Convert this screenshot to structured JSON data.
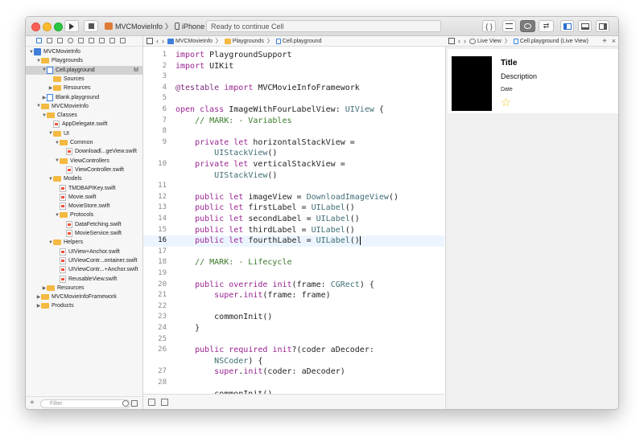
{
  "toolbar": {
    "scheme": "MVCMovieInfo",
    "device": "iPhone Xs",
    "status": "Ready to continue Cell",
    "curly_label": "{ }"
  },
  "navigator": {
    "filter_placeholder": "Filter",
    "tree": [
      {
        "label": "MVCMovieInfo",
        "icon": "project",
        "depth": 0,
        "disclosure": "open"
      },
      {
        "label": "Playgrounds",
        "icon": "folder",
        "depth": 1,
        "disclosure": "open"
      },
      {
        "label": "Cell.playground",
        "icon": "playground",
        "depth": 2,
        "disclosure": "open",
        "selected": true,
        "badge": "M"
      },
      {
        "label": "Sources",
        "icon": "folder",
        "depth": 3,
        "disclosure": "none"
      },
      {
        "label": "Resources",
        "icon": "folder",
        "depth": 3,
        "disclosure": "closed"
      },
      {
        "label": "Blank.playground",
        "icon": "playground",
        "depth": 2,
        "disclosure": "closed"
      },
      {
        "label": "MVCMovieInfo",
        "icon": "folder",
        "depth": 1,
        "disclosure": "open"
      },
      {
        "label": "Classes",
        "icon": "folder",
        "depth": 2,
        "disclosure": "open"
      },
      {
        "label": "AppDelegate.swift",
        "icon": "swift",
        "depth": 3,
        "disclosure": "none"
      },
      {
        "label": "UI",
        "icon": "folder",
        "depth": 3,
        "disclosure": "open"
      },
      {
        "label": "Common",
        "icon": "folder",
        "depth": 4,
        "disclosure": "open"
      },
      {
        "label": "Downloadl...geView.swift",
        "icon": "swift",
        "depth": 5,
        "disclosure": "none"
      },
      {
        "label": "ViewControllers",
        "icon": "folder",
        "depth": 4,
        "disclosure": "open"
      },
      {
        "label": "ViewController.swift",
        "icon": "swift",
        "depth": 5,
        "disclosure": "none"
      },
      {
        "label": "Models",
        "icon": "folder",
        "depth": 3,
        "disclosure": "open"
      },
      {
        "label": "TMDBAPIKey.swift",
        "icon": "swift",
        "depth": 4,
        "disclosure": "none"
      },
      {
        "label": "Movie.swift",
        "icon": "swift",
        "depth": 4,
        "disclosure": "none"
      },
      {
        "label": "MovieStore.swift",
        "icon": "swift",
        "depth": 4,
        "disclosure": "none"
      },
      {
        "label": "Protocols",
        "icon": "folder",
        "depth": 4,
        "disclosure": "open"
      },
      {
        "label": "DataFetching.swift",
        "icon": "swift",
        "depth": 5,
        "disclosure": "none"
      },
      {
        "label": "MovieService.swift",
        "icon": "swift",
        "depth": 5,
        "disclosure": "none"
      },
      {
        "label": "Helpers",
        "icon": "folder",
        "depth": 3,
        "disclosure": "open"
      },
      {
        "label": "UIView+Anchor.swift",
        "icon": "swift",
        "depth": 4,
        "disclosure": "none"
      },
      {
        "label": "UIViewContr...ontainer.swift",
        "icon": "swift",
        "depth": 4,
        "disclosure": "none"
      },
      {
        "label": "UIViewContr...+Anchor.swift",
        "icon": "swift",
        "depth": 4,
        "disclosure": "none"
      },
      {
        "label": "ReusableView.swift",
        "icon": "swift",
        "depth": 4,
        "disclosure": "none"
      },
      {
        "label": "Resources",
        "icon": "folder",
        "depth": 2,
        "disclosure": "closed"
      },
      {
        "label": "MVCMovieInfoFramework",
        "icon": "folder",
        "depth": 1,
        "disclosure": "closed"
      },
      {
        "label": "Products",
        "icon": "folder",
        "depth": 1,
        "disclosure": "closed"
      }
    ]
  },
  "editor": {
    "breadcrumbs": [
      "MVCMovieInfo",
      "Playgrounds",
      "Cell.playground"
    ],
    "current_line": 16,
    "lines": [
      {
        "n": "1",
        "tokens": [
          [
            "kw",
            "import"
          ],
          [
            "",
            " PlaygroundSupport"
          ]
        ]
      },
      {
        "n": "2",
        "tokens": [
          [
            "kw",
            "import"
          ],
          [
            "",
            " UIKit"
          ]
        ]
      },
      {
        "n": "3",
        "tokens": []
      },
      {
        "n": "4",
        "tokens": [
          [
            "at",
            "@testable"
          ],
          [
            "",
            " "
          ],
          [
            "kw",
            "import"
          ],
          [
            "",
            " MVCMovieInfoFramework"
          ]
        ]
      },
      {
        "n": "5",
        "tokens": []
      },
      {
        "n": "6",
        "tokens": [
          [
            "kw",
            "open class"
          ],
          [
            "",
            " ImageWithFourLabelView: "
          ],
          [
            "ty",
            "UIView"
          ],
          [
            "",
            " {"
          ]
        ]
      },
      {
        "n": "7",
        "tokens": [
          [
            "cm",
            "    // MARK: - Variables"
          ]
        ]
      },
      {
        "n": "8",
        "tokens": []
      },
      {
        "n": "9",
        "tokens": [
          [
            "",
            "    "
          ],
          [
            "kw",
            "private let"
          ],
          [
            "",
            " horizontalStackView ="
          ]
        ]
      },
      {
        "n": "",
        "tokens": [
          [
            "",
            "        "
          ],
          [
            "ty",
            "UIStackView"
          ],
          [
            "",
            "()"
          ]
        ]
      },
      {
        "n": "10",
        "tokens": [
          [
            "",
            "    "
          ],
          [
            "kw",
            "private let"
          ],
          [
            "",
            " verticalStackView ="
          ]
        ]
      },
      {
        "n": "",
        "tokens": [
          [
            "",
            "        "
          ],
          [
            "ty",
            "UIStackView"
          ],
          [
            "",
            "()"
          ]
        ]
      },
      {
        "n": "11",
        "tokens": []
      },
      {
        "n": "12",
        "tokens": [
          [
            "",
            "    "
          ],
          [
            "kw",
            "public let"
          ],
          [
            "",
            " imageView = "
          ],
          [
            "ty",
            "DownloadImageView"
          ],
          [
            "",
            "()"
          ]
        ]
      },
      {
        "n": "13",
        "tokens": [
          [
            "",
            "    "
          ],
          [
            "kw",
            "public let"
          ],
          [
            "",
            " firstLabel = "
          ],
          [
            "ty",
            "UILabel"
          ],
          [
            "",
            "()"
          ]
        ]
      },
      {
        "n": "14",
        "tokens": [
          [
            "",
            "    "
          ],
          [
            "kw",
            "public let"
          ],
          [
            "",
            " secondLabel = "
          ],
          [
            "ty",
            "UILabel"
          ],
          [
            "",
            "()"
          ]
        ]
      },
      {
        "n": "15",
        "tokens": [
          [
            "",
            "    "
          ],
          [
            "kw",
            "public let"
          ],
          [
            "",
            " thirdLabel = "
          ],
          [
            "ty",
            "UILabel"
          ],
          [
            "",
            "()"
          ]
        ]
      },
      {
        "n": "16",
        "tokens": [
          [
            "",
            "    "
          ],
          [
            "kw",
            "public let"
          ],
          [
            "",
            " fourthLabel = "
          ],
          [
            "ty",
            "UILabel"
          ],
          [
            "",
            "()"
          ]
        ],
        "caret": true
      },
      {
        "n": "17",
        "tokens": []
      },
      {
        "n": "18",
        "tokens": [
          [
            "cm",
            "    // MARK: - Lifecycle"
          ]
        ]
      },
      {
        "n": "19",
        "tokens": []
      },
      {
        "n": "20",
        "tokens": [
          [
            "",
            "    "
          ],
          [
            "kw",
            "public override init"
          ],
          [
            "",
            "(frame: "
          ],
          [
            "ty",
            "CGRect"
          ],
          [
            "",
            ") {"
          ]
        ]
      },
      {
        "n": "21",
        "tokens": [
          [
            "",
            "        "
          ],
          [
            "kw",
            "super"
          ],
          [
            "",
            "."
          ],
          [
            "kw",
            "init"
          ],
          [
            "",
            "(frame: frame)"
          ]
        ]
      },
      {
        "n": "22",
        "tokens": []
      },
      {
        "n": "23",
        "tokens": [
          [
            "",
            "        commonInit()"
          ]
        ]
      },
      {
        "n": "24",
        "tokens": [
          [
            "",
            "    }"
          ]
        ]
      },
      {
        "n": "25",
        "tokens": []
      },
      {
        "n": "26",
        "tokens": [
          [
            "",
            "    "
          ],
          [
            "kw",
            "public required init"
          ],
          [
            "",
            "?(coder aDecoder:"
          ]
        ]
      },
      {
        "n": "",
        "tokens": [
          [
            "",
            "        "
          ],
          [
            "ty",
            "NSCoder"
          ],
          [
            "",
            ") {"
          ]
        ]
      },
      {
        "n": "27",
        "tokens": [
          [
            "",
            "        "
          ],
          [
            "kw",
            "super"
          ],
          [
            "",
            "."
          ],
          [
            "kw",
            "init"
          ],
          [
            "",
            "(coder: aDecoder)"
          ]
        ]
      },
      {
        "n": "28",
        "tokens": []
      },
      {
        "n": "",
        "tokens": [
          [
            "",
            "        commonInit()"
          ]
        ]
      },
      {
        "n": "29",
        "tokens": []
      }
    ]
  },
  "liveview": {
    "breadcrumbs": [
      "Live View",
      "Cell.playground (Live View)"
    ],
    "card": {
      "title": "Title",
      "description": "Description",
      "date": "Date",
      "star": "☆"
    }
  },
  "colors": {
    "selection": "#d2d2d2",
    "current_line": "#ecf5ff",
    "keyword": "#9b2393",
    "type": "#3e6d74",
    "comment": "#3a7a28",
    "folder": "#f4b941",
    "star": "#f5c518"
  }
}
